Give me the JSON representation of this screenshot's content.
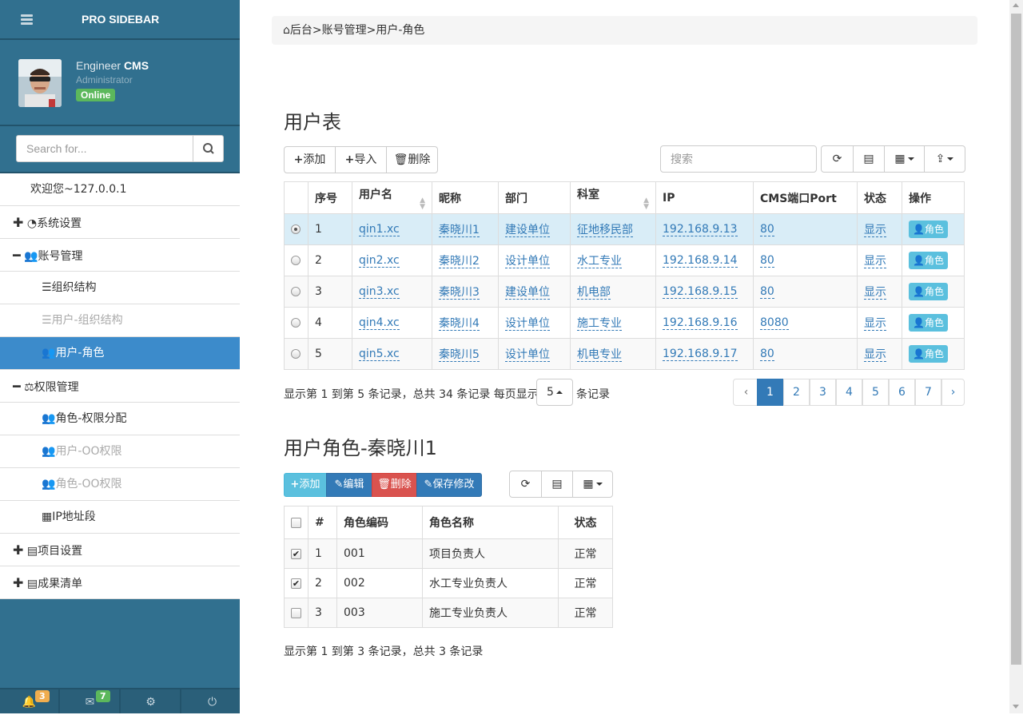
{
  "sidebar": {
    "brand": "PRO SIDEBAR",
    "user": {
      "first": "Engineer ",
      "last": "CMS",
      "role": "Administrator",
      "status": "Online"
    },
    "search_placeholder": "Search for...",
    "welcome": "欢迎您~127.0.0.1",
    "items": [
      {
        "label": "系统设置"
      },
      {
        "label": "账号管理"
      },
      {
        "label": "组织结构"
      },
      {
        "label": "用户-组织结构"
      },
      {
        "label": "用户-角色"
      },
      {
        "label": "权限管理"
      },
      {
        "label": "角色-权限分配"
      },
      {
        "label": "用户-OO权限"
      },
      {
        "label": "角色-OO权限"
      },
      {
        "label": "IP地址段"
      },
      {
        "label": "项目设置"
      },
      {
        "label": "成果清单"
      }
    ],
    "footer": {
      "notif_count": "3",
      "mail_count": "7"
    }
  },
  "breadcrumb": "后台>账号管理>用户-角色",
  "users": {
    "title": "用户表",
    "buttons": {
      "add": "添加",
      "import": "导入",
      "delete": "删除"
    },
    "search_placeholder": "搜索",
    "columns": [
      "序号",
      "用户名",
      "昵称",
      "部门",
      "科室",
      "IP",
      "CMS端口Port",
      "状态",
      "操作"
    ],
    "rows": [
      {
        "no": "1",
        "username": "qin1.xc",
        "nick": "秦晓川1",
        "dept": "建设单位",
        "office": "征地移民部",
        "ip": "192.168.9.13",
        "port": "80",
        "status": "显示",
        "action": "角色"
      },
      {
        "no": "2",
        "username": "qin2.xc",
        "nick": "秦晓川2",
        "dept": "设计单位",
        "office": "水工专业",
        "ip": "192.168.9.14",
        "port": "80",
        "status": "显示",
        "action": "角色"
      },
      {
        "no": "3",
        "username": "qin3.xc",
        "nick": "秦晓川3",
        "dept": "建设单位",
        "office": "机电部",
        "ip": "192.168.9.15",
        "port": "80",
        "status": "显示",
        "action": "角色"
      },
      {
        "no": "4",
        "username": "qin4.xc",
        "nick": "秦晓川4",
        "dept": "设计单位",
        "office": "施工专业",
        "ip": "192.168.9.16",
        "port": "8080",
        "status": "显示",
        "action": "角色"
      },
      {
        "no": "5",
        "username": "qin5.xc",
        "nick": "秦晓川5",
        "dept": "设计单位",
        "office": "机电专业",
        "ip": "192.168.9.17",
        "port": "80",
        "status": "显示",
        "action": "角色"
      }
    ],
    "info_prefix": "显示第 1 到第 5 条记录，总共 34 条记录 每页显示",
    "page_size": "5",
    "info_suffix": "条记录",
    "pages": [
      "‹",
      "1",
      "2",
      "3",
      "4",
      "5",
      "6",
      "7",
      "›"
    ],
    "current_page": "1"
  },
  "roles": {
    "title": "用户角色-秦晓川1",
    "buttons": {
      "add": "添加",
      "edit": "编辑",
      "delete": "删除",
      "save": "保存修改"
    },
    "columns": [
      "#",
      "角色编码",
      "角色名称",
      "状态"
    ],
    "rows": [
      {
        "no": "1",
        "code": "001",
        "name": "项目负责人",
        "status": "正常",
        "checked": true
      },
      {
        "no": "2",
        "code": "002",
        "name": "水工专业负责人",
        "status": "正常",
        "checked": true
      },
      {
        "no": "3",
        "code": "003",
        "name": "施工专业负责人",
        "status": "正常",
        "checked": false
      }
    ],
    "info": "显示第 1 到第 3 条记录，总共 3 条记录"
  },
  "colors": {
    "sidebar": "#31708f",
    "active": "#3c8bcb",
    "primary": "#337ab7",
    "info": "#5bc0de",
    "danger": "#d9534f",
    "success": "#5cb85c",
    "warning": "#f0ad4e"
  }
}
